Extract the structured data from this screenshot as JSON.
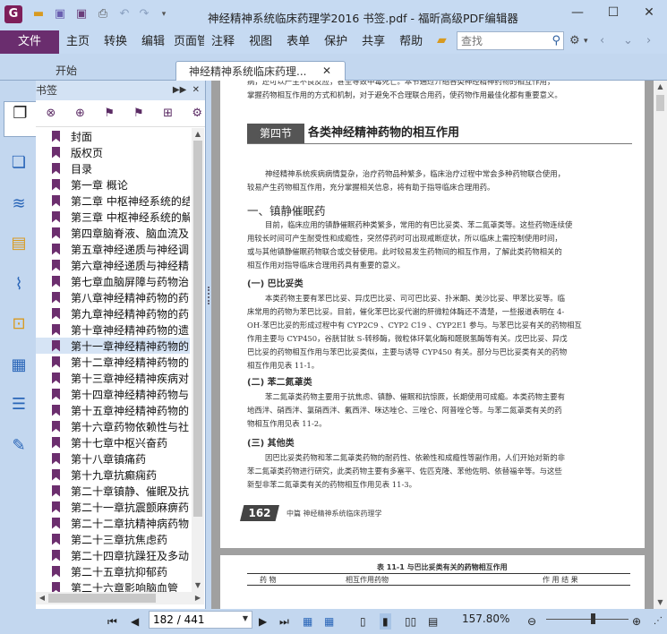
{
  "app": {
    "logo_letter": "G",
    "title": "神经精神系统临床药理学2016 书签.pdf - 福昕高级PDF编辑器"
  },
  "quick_icons": [
    "open-folder-icon",
    "save-icon",
    "save-as-icon",
    "print-icon",
    "undo-icon",
    "redo-icon",
    "customize-icon"
  ],
  "menu": {
    "file": "文件",
    "items": [
      "主页",
      "转换",
      "编辑",
      "页面管",
      "注释",
      "视图",
      "表单",
      "保护",
      "共享",
      "帮助"
    ]
  },
  "search": {
    "placeholder": "查找",
    "value": ""
  },
  "tabs": [
    {
      "label": "开始",
      "active": false
    },
    {
      "label": "神经精神系统临床药理...",
      "active": true
    }
  ],
  "bookmarks": {
    "panel_title": "书签",
    "items": [
      "封面",
      "版权页",
      "目录",
      "第一章 概论",
      "第二章 中枢神经系统的结",
      "第三章 中枢神经系统的解",
      "第四章脑脊液、脑血流及",
      "第五章神经递质与神经调",
      "第六章神经递质与神经精",
      "第七章血脑屏障与药物治",
      "第八章神经精神药物的药",
      "第九章神经精神药物的药",
      "第十章神经精神药物的遗",
      "第十一章神经精神药物的",
      "第十二章神经精神药物的",
      "第十三章神经精神疾病对",
      "第十四章神经精神药物与",
      "第十五章神经精神药物的",
      "第十六章药物依赖性与社",
      "第十七章中枢兴奋药",
      "第十八章镇痛药",
      "第十九章抗癫痫药",
      "第二十章镇静、催眠及抗",
      "第二十一章抗震颤麻痹药",
      "第二十二章抗精神病药物",
      "第二十三章抗焦虑药",
      "第二十四章抗躁狂及多动",
      "第二十五章抗抑郁药",
      "第二十六章影响脑血管"
    ],
    "selected_index": 13
  },
  "document": {
    "top_lines": [
      "病，还可以产生不良反应，甚至导致中毒死亡。本节通过介绍各类神经精神药物的相互作用，",
      "掌握药物相互作用的方式和机制，对于避免不合理联合用药，使药物作用最佳化都有重要意义。"
    ],
    "section_label": "第四节",
    "section_title": "各类神经精神药物的相互作用",
    "intro": [
      "神经精神系统疾病病情复杂，治疗药物品种繁多，临床治疗过程中常会多种药物联合使用，",
      "较易产生药物相互作用，充分掌握相关信息，将有助于指导临床合理用药。"
    ],
    "h_sedative": "一、镇静催眠药",
    "sedative_para": [
      "目前，临床应用的镇静催眠药种类繁多，常用的有巴比妥类、苯二氮䓬类等。这些药物连续使",
      "用较长时间可产生耐受性和成瘾性，突然停药时可出现戒断症状，所以临床上需控制使用时间，",
      "或与其他镇静催眠药物联合或交替使用。此时较易发生药物间的相互作用，了解此类药物相关的",
      "相互作用对指导临床合理用药具有重要的意义。"
    ],
    "h_barbiturate": "(一) 巴比妥类",
    "barbiturate_para": [
      "本类药物主要有苯巴比妥、异戊巴比妥、司可巴比妥、扑米酮、美沙比妥、甲苯比妥等。临",
      "床常用的药物为苯巴比妥。目前，催化苯巴比妥代谢的肝微粒体酶还不清楚，一些报道表明在 4-",
      "OH-苯巴比妥的形成过程中有 CYP2C9 、CYP2 C19 、CYP2E1 参与。与苯巴比妥有关的药物相互",
      "作用主要与 CYP450，谷胱甘肽 S-转移酶，微粒体环氧化酶和醛脱氢酶等有关。戊巴比妥、异戊",
      "巴比妥的药物相互作用与苯巴比妥类似，主要与诱导 CYP450 有关。部分与巴比妥类有关的药物",
      "相互作用见表 11-1。"
    ],
    "h_benzo": "(二) 苯二氮䓬类",
    "benzo_para": [
      "苯二氮䓬类药物主要用于抗焦虑、镇静、催眠和抗惊厥，长期使用可成瘾。本类药物主要有",
      "地西泮、硝西泮、氯硝西泮、氟西泮、咪达唑仑、三唑仑、阿普唑仑等。与苯二氮䓬类有关的药",
      "物相互作用见表 11-2。"
    ],
    "h_other": "(三) 其他类",
    "other_para": [
      "因巴比妥类药物和苯二氮䓬类药物的耐药性、依赖性和成瘾性等副作用，人们开始对新的非",
      "苯二氮䓬类药物进行研究，此类药物主要有多塞平、佐匹克隆、苯他佐明、依替福辛等。与这些",
      "新型非苯二氮䓬类有关的药物相互作用见表 11-3。"
    ],
    "page_number": "162",
    "footer": "中篇  神经精神系统临床药理学",
    "table_title": "表 11-1  与巴比妥类有关的药物相互作用",
    "table_headers": [
      "药  物",
      "相互作用药物",
      "作 用 结 果"
    ]
  },
  "status": {
    "page_value": "182 / 441",
    "zoom": "157.80%"
  }
}
